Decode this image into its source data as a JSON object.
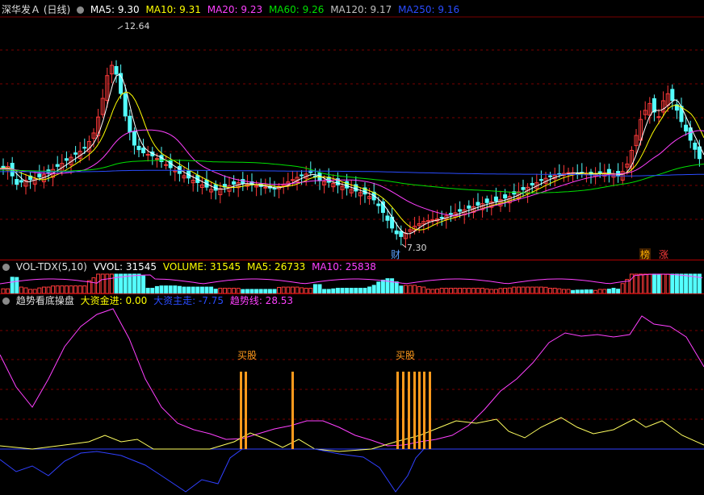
{
  "colors": {
    "up": "#ff3a3a",
    "down": "#54ffff",
    "ma5": "#ffffff",
    "ma10": "#ffff00",
    "ma20": "#ff40ff",
    "ma60": "#00e000",
    "ma120": "#c0c0c0",
    "ma250": "#2a4cff",
    "grid": "#7a0000",
    "vol": "#ff40ff",
    "buy": "#ff9a1c",
    "big": "#ff40ff",
    "main": "#3040ff",
    "trend": "#ffff60"
  },
  "price_panel": {
    "title": "深华发Ａ (日线)",
    "ma_labels": [
      {
        "key": "ma5",
        "text": "MA5: 9.30"
      },
      {
        "key": "ma10",
        "text": "MA10: 9.31"
      },
      {
        "key": "ma20",
        "text": "MA20: 9.23"
      },
      {
        "key": "ma60",
        "text": "MA60: 9.26"
      },
      {
        "key": "ma120",
        "text": "MA120: 9.17"
      },
      {
        "key": "ma250",
        "text": "MA250: 9.16"
      }
    ],
    "high_label": "12.64",
    "low_label": "7.30",
    "markers": [
      {
        "text": "财",
        "color": "#5aa0ff"
      },
      {
        "text": "榜",
        "color": "#ffb000"
      },
      {
        "text": "涨",
        "color": "#ff3a3a"
      }
    ]
  },
  "volume_panel": {
    "title": "VOL-TDX(5,10)",
    "labels": [
      "VVOL: 31545",
      "VOLUME: 31545",
      "MA5: 26733",
      "MA10: 25838"
    ]
  },
  "indicator_panel": {
    "title": "趋势看底操盘",
    "labels": [
      {
        "key": "big",
        "text": "大资金进: 0.00"
      },
      {
        "key": "main",
        "text": "大资主走: -7.75"
      },
      {
        "key": "trend",
        "text": "趋势线: 28.53"
      }
    ],
    "buy_label_1": "买股",
    "buy_label_2": "买股"
  }
}
